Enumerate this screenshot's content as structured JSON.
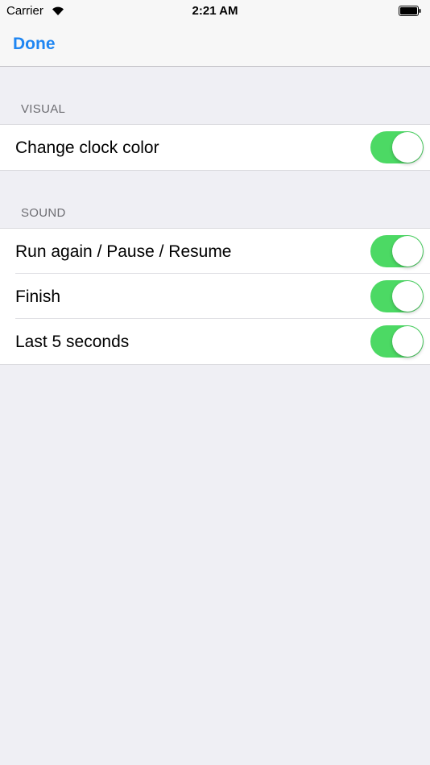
{
  "status_bar": {
    "carrier": "Carrier",
    "time": "2:21 AM",
    "icons": [
      "wifi-icon",
      "battery-icon"
    ]
  },
  "nav": {
    "done_label": "Done",
    "accent_color": "#1f86f2"
  },
  "sections": [
    {
      "header": "VISUAL",
      "rows": [
        {
          "label": "Change clock color",
          "enabled": true
        }
      ]
    },
    {
      "header": "SOUND",
      "rows": [
        {
          "label": "Run again / Pause / Resume",
          "enabled": true
        },
        {
          "label": "Finish",
          "enabled": true
        },
        {
          "label": "Last 5 seconds",
          "enabled": true
        }
      ]
    }
  ],
  "colors": {
    "toggle_on": "#4cd964",
    "background": "#efeff4"
  }
}
